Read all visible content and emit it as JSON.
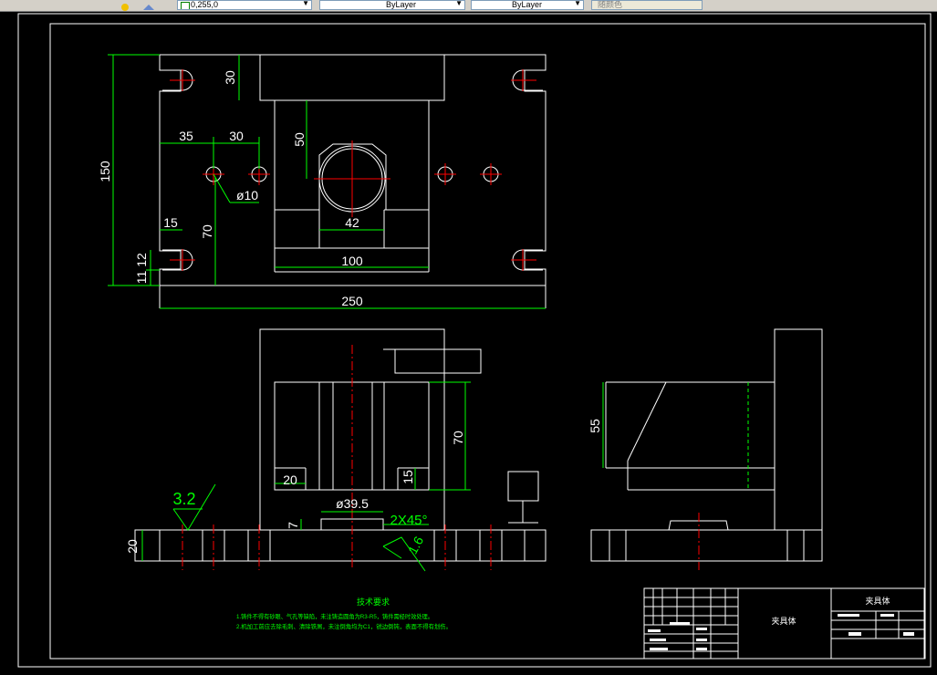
{
  "toolbar": {
    "color_value": "0,255,0",
    "linetype_value": "ByLayer",
    "lineweight_value": "ByLayer",
    "plotstyle_value": "随颜色"
  },
  "colors": {
    "background": "#000000",
    "outline": "#ffffff",
    "dimension": "#00ff00",
    "centerline": "#ff0000",
    "note_text": "#00ff00"
  },
  "dimensions": {
    "top_view": [
      "30",
      "150",
      "35",
      "30",
      "50",
      "ø10",
      "42",
      "15",
      "70",
      "11",
      "12",
      "100",
      "250"
    ],
    "front_view": [
      "70",
      "20",
      "15",
      "ø39.5",
      "2X45°",
      "7",
      "20"
    ],
    "side_view": [
      "55"
    ]
  },
  "surface_finish": {
    "main": "3.2",
    "chamfer": "1.6"
  },
  "technical_requirements": {
    "title": "技术要求",
    "items": [
      "1.铸件不得有砂眼、气孔等缺陷，未注铸造圆角为R3-R5，铸件需经时效处理。",
      "2.机加工前应去除毛刺、清除铁屑，未注倒角均为C1，锐边倒钝，表面不得有划伤。"
    ]
  },
  "title_block": {
    "part_name": "夹具体",
    "drawing_name": "夹具体"
  }
}
